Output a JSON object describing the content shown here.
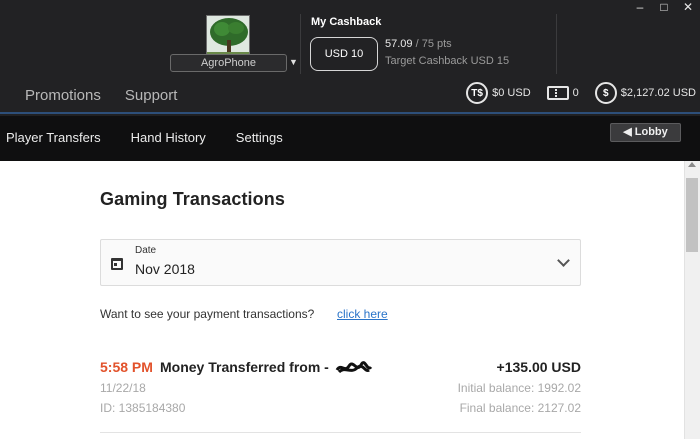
{
  "window": {
    "minimize": "–",
    "maximize": "□",
    "close": "✕"
  },
  "profile": {
    "nickname": "AgroPhone",
    "avatar_icon": "tree-avatar",
    "dropdown_icon": "caret-down"
  },
  "cashback": {
    "title": "My Cashback",
    "level_label": "USD 10",
    "points": "57.09",
    "points_total": "/ 75 pts",
    "target": "Target Cashback USD 15"
  },
  "nav": {
    "items": [
      "Promotions",
      "Support"
    ]
  },
  "balances": {
    "tournament_dollars": {
      "icon": "T$",
      "value": "$0 USD"
    },
    "tickets": {
      "value": "0"
    },
    "cash": {
      "icon": "$",
      "value": "$2,127.02 USD"
    }
  },
  "tabs": [
    "Player Transfers",
    "Hand History",
    "Settings"
  ],
  "lobby_button": "Lobby",
  "lobby_icon": "back-arrow",
  "page": {
    "title": "Gaming Transactions",
    "date_filter": {
      "label": "Date",
      "value": "Nov 2018"
    },
    "payment_question": "Want to see your payment transactions?",
    "payment_link": "click here"
  },
  "transactions": [
    {
      "time": "5:58 PM",
      "title": "Money Transferred from -",
      "amount": "+135.00 USD",
      "date": "11/22/18",
      "id": "ID: 1385184380",
      "initial_balance": "Initial balance: 1992.02",
      "final_balance": "Final balance: 2127.02"
    }
  ],
  "colors": {
    "accent_time": "#e2522b",
    "link": "#2a74c9",
    "header_bg": "#222224",
    "tabbar_bg": "#0f0f10"
  }
}
